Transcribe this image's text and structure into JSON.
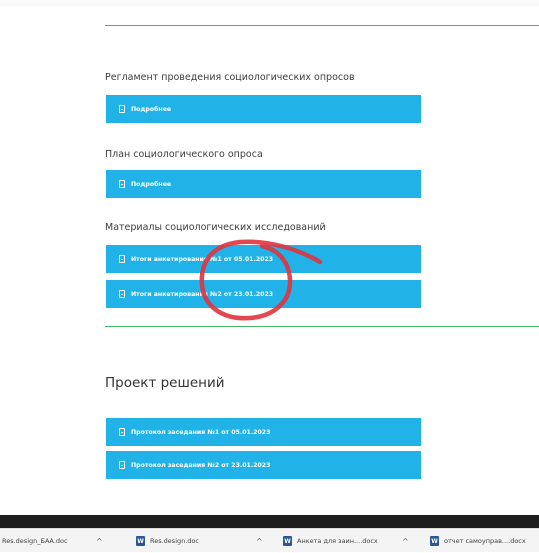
{
  "sections": [
    {
      "title": "Регламент проведения социологических опросов",
      "button": "Подробнее"
    },
    {
      "title": "План социологического опроса",
      "button": "Подробнее"
    },
    {
      "title": "Материалы социологических исследований",
      "buttons": [
        "Итоги анкетирования №1 от 05.01.2023",
        "Итоги анкетирования №2 от 23.01.2023"
      ]
    }
  ],
  "decisions": {
    "title": "Проект решений",
    "buttons": [
      "Протокол заседания №1 от 05.01.2023",
      "Протокол заседания №2 от 23.01.2023"
    ]
  },
  "downloads": [
    {
      "name": "Res.design_БАА.doc",
      "icon": "word-icon"
    },
    {
      "name": "Res.design.doc",
      "icon": "word-icon"
    },
    {
      "name": "Анкета для заин....docx",
      "icon": "word-icon"
    },
    {
      "name": "отчет самоупрaв....docx",
      "icon": "word-icon"
    }
  ],
  "colors": {
    "accent": "#21b3e8",
    "divider": "#4bb36a",
    "annotation": "#e0333f"
  }
}
